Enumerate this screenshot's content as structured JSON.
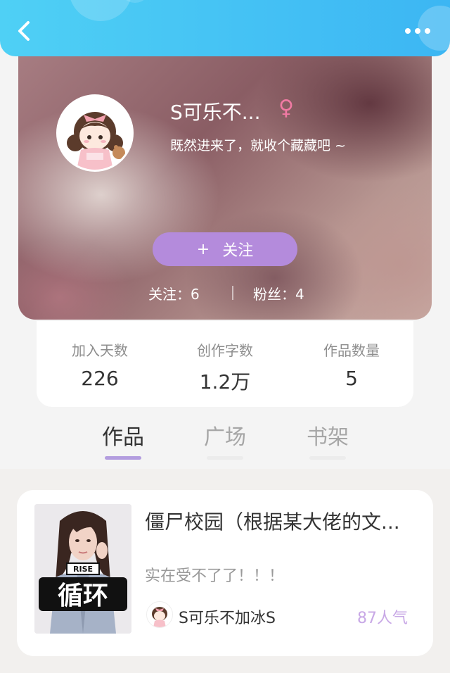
{
  "header": {
    "back_icon": "chevron-left-icon",
    "more_icon": "more-dots-icon",
    "accent_color": "#3cb6f3"
  },
  "profile": {
    "nickname": "S可乐不...",
    "gender_symbol": "♀",
    "bio": "既然进来了，就收个藏藏吧 ~",
    "follow_button_plus": "+",
    "follow_button_label": "关注",
    "following_text": "关注：6",
    "fans_text": "粉丝：4"
  },
  "stats": [
    {
      "label": "加入天数",
      "value": "226"
    },
    {
      "label": "创作字数",
      "value": "1.2万"
    },
    {
      "label": "作品数量",
      "value": "5"
    }
  ],
  "tabs": [
    {
      "label": "作品",
      "active": true
    },
    {
      "label": "广场",
      "active": false
    },
    {
      "label": "书架",
      "active": false
    }
  ],
  "work": {
    "title": "僵尸校园（根据某大佬的文...",
    "description": "实在受不了了！！！",
    "author": "S可乐不加冰S",
    "popularity": "87人气",
    "cover_badge_top": "RISE",
    "cover_badge_main": "循环"
  }
}
